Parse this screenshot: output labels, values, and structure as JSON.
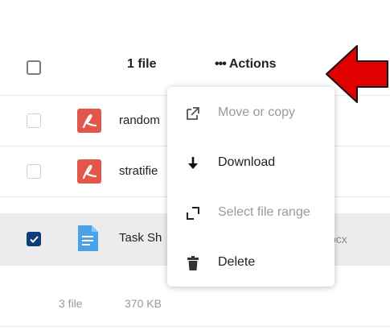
{
  "header": {
    "selected_count": "1 file",
    "actions_dots": "•••",
    "actions_label": "Actions"
  },
  "files": [
    {
      "name": "random",
      "type": "pdf",
      "checked": false
    },
    {
      "name": "stratifie",
      "type": "pdf",
      "checked": false
    },
    {
      "name": "Task Sh",
      "type": "doc",
      "ext": "ocx",
      "checked": true
    }
  ],
  "footer": {
    "count": "3 file",
    "size": "370 KB"
  },
  "menu": {
    "items": [
      {
        "label": "Move or copy",
        "icon": "external-link-icon",
        "disabled": true
      },
      {
        "label": "Download",
        "icon": "download-arrow-icon",
        "disabled": false
      },
      {
        "label": "Select file range",
        "icon": "select-range-icon",
        "disabled": true
      },
      {
        "label": "Delete",
        "icon": "trash-icon",
        "disabled": false
      }
    ]
  },
  "colors": {
    "pdf_red": "#e2574c",
    "doc_blue": "#4aa3e8",
    "checked_blue": "#0b3d7a",
    "arrow_red": "#e00000",
    "selected_row": "#ececec"
  }
}
